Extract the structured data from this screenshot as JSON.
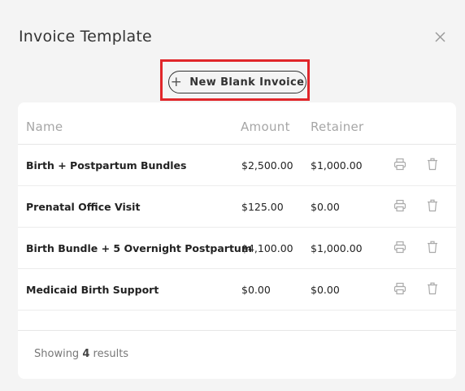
{
  "modal": {
    "title": "Invoice Template",
    "close_icon": "close-icon",
    "new_button": {
      "icon": "plus-icon",
      "label": "New Blank Invoice"
    },
    "highlight_color": "#e0262a"
  },
  "table": {
    "columns": [
      "Name",
      "Amount",
      "Retainer"
    ],
    "rows": [
      {
        "name": "Birth + Postpartum Bundles",
        "amount": "$2,500.00",
        "retainer": "$1,000.00"
      },
      {
        "name": "Prenatal Office Visit",
        "amount": "$125.00",
        "retainer": "$0.00"
      },
      {
        "name": "Birth Bundle + 5 Overnight Postpartum",
        "amount": "$4,100.00",
        "retainer": "$1,000.00"
      },
      {
        "name": "Medicaid Birth Support",
        "amount": "$0.00",
        "retainer": "$0.00"
      }
    ],
    "row_icons": [
      "printer-icon",
      "trash-icon"
    ]
  },
  "footer": {
    "prefix": "Showing",
    "count": "4",
    "suffix": "results"
  }
}
